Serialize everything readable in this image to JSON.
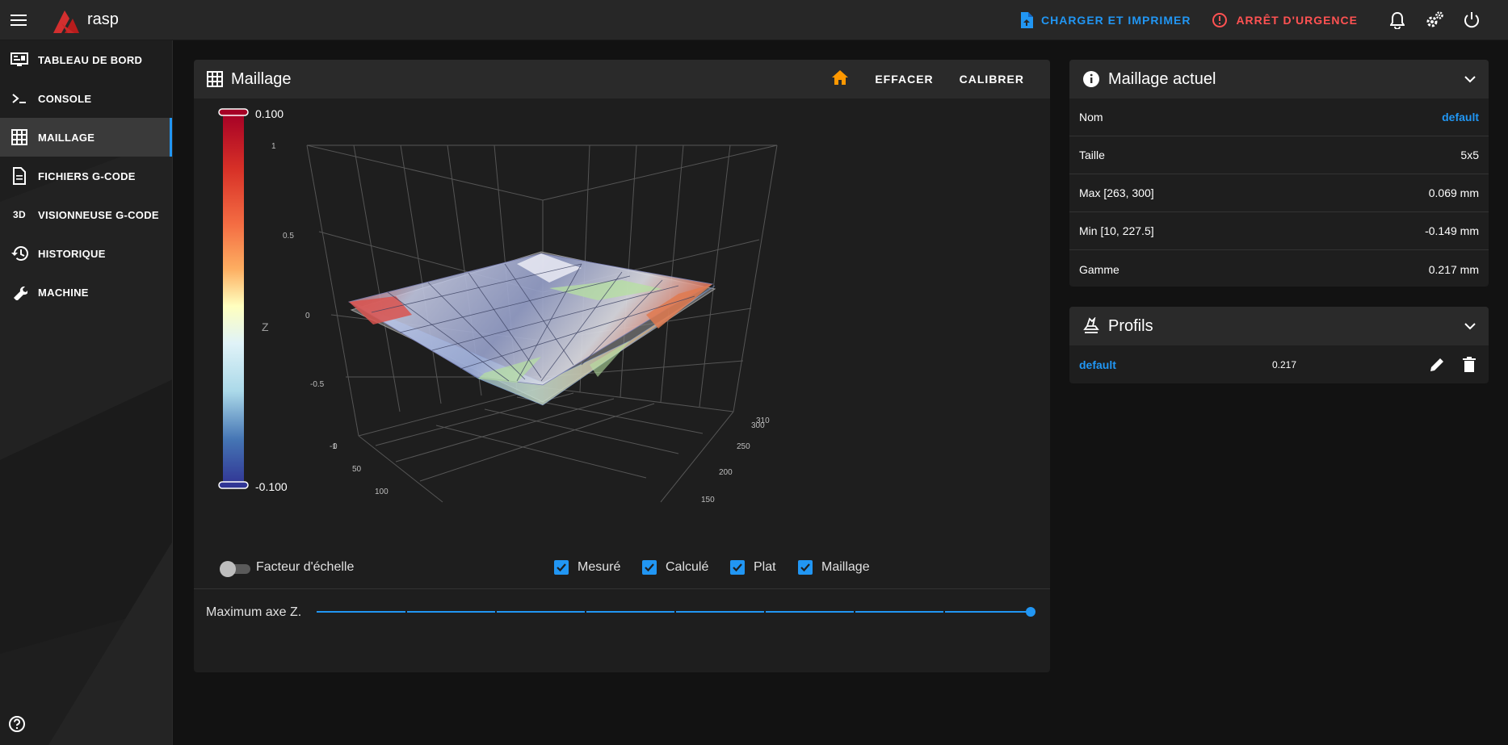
{
  "app": {
    "title": "rasp"
  },
  "topbar": {
    "upload_print": "CHARGER ET IMPRIMER",
    "emergency_stop": "ARRÊT D'URGENCE"
  },
  "sidebar": {
    "items": [
      {
        "label": "TABLEAU DE BORD",
        "icon": "monitor-dashboard-icon"
      },
      {
        "label": "CONSOLE",
        "icon": "console-icon"
      },
      {
        "label": "MAILLAGE",
        "icon": "grid-icon"
      },
      {
        "label": "FICHIERS G-CODE",
        "icon": "file-document-icon"
      },
      {
        "label": "VISIONNEUSE G-CODE",
        "icon": "3d-icon"
      },
      {
        "label": "HISTORIQUE",
        "icon": "history-icon"
      },
      {
        "label": "MACHINE",
        "icon": "wrench-icon"
      }
    ],
    "active_index": 2
  },
  "mesh": {
    "title": "Maillage",
    "clear_label": "EFFACER",
    "calibrate_label": "CALIBRER",
    "scale_factor_label": "Facteur d'échelle",
    "checkboxes": [
      {
        "label": "Mesuré",
        "checked": true
      },
      {
        "label": "Calculé",
        "checked": true
      },
      {
        "label": "Plat",
        "checked": true
      },
      {
        "label": "Maillage",
        "checked": true
      }
    ],
    "z_max_label": "Maximum axe Z."
  },
  "chart_data": {
    "type": "surface3d",
    "colorbar": {
      "max": "0.100",
      "min": "-0.100",
      "label": "Z"
    },
    "z_ticks": [
      "1",
      "0.5",
      "0",
      "-0.5",
      "-1"
    ],
    "x_ticks": [
      "0",
      "50",
      "100"
    ],
    "y_ticks": [
      "150",
      "200",
      "250",
      "300",
      "310"
    ],
    "z_slider_fraction": 1.0
  },
  "current_mesh": {
    "title": "Maillage actuel",
    "rows": [
      {
        "label": "Nom",
        "value": "default",
        "link": true
      },
      {
        "label": "Taille",
        "value": "5x5"
      },
      {
        "label": "Max [263, 300]",
        "value": "0.069 mm"
      },
      {
        "label": "Min [10, 227.5]",
        "value": "-0.149 mm"
      },
      {
        "label": "Gamme",
        "value": "0.217 mm"
      }
    ]
  },
  "profiles": {
    "title": "Profils",
    "items": [
      {
        "name": "default",
        "range": "0.217"
      }
    ]
  },
  "colors": {
    "accent": "#2196f3",
    "danger": "#ff5252",
    "home": "#ff9800"
  }
}
